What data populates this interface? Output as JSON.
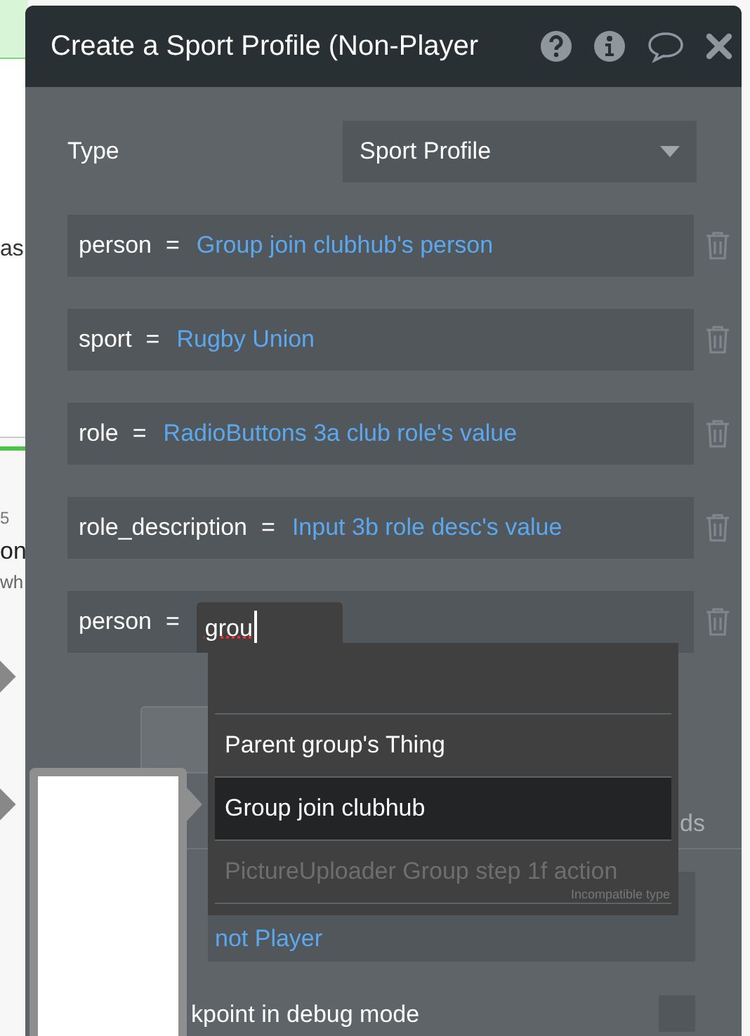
{
  "background_fragments": [
    {
      "text": "as"
    },
    {
      "text": "5"
    },
    {
      "text": "on"
    },
    {
      "text": "wh"
    }
  ],
  "dialog": {
    "title": "Create a Sport Profile (Non-Player",
    "type_label": "Type",
    "type_value": "Sport Profile",
    "fields": [
      {
        "key": "person",
        "operator": "=",
        "value": "Group join clubhub's person",
        "kind": "expression"
      },
      {
        "key": "sport",
        "operator": "=",
        "value": "Rugby Union",
        "kind": "expression"
      },
      {
        "key": "role",
        "operator": "=",
        "value": "RadioButtons 3a club role's value",
        "kind": "expression"
      },
      {
        "key": "role_description",
        "operator": "=",
        "value": "Input 3b role desc's value",
        "kind": "expression"
      },
      {
        "key": "person",
        "operator": "=",
        "value": "grou",
        "kind": "editing"
      }
    ],
    "autocomplete": {
      "items": [
        {
          "label": "Parent group's Thing",
          "selected": false,
          "disabled": false
        },
        {
          "label": "Group join clubhub",
          "selected": true,
          "disabled": false
        },
        {
          "label": "PictureUploader Group step 1f action",
          "selected": false,
          "disabled": true,
          "note": "Incompatible type"
        }
      ]
    },
    "behind": {
      "column_text": "ds",
      "value": "not Player",
      "checkbox_label": "kpoint in debug mode",
      "checked": false
    }
  }
}
